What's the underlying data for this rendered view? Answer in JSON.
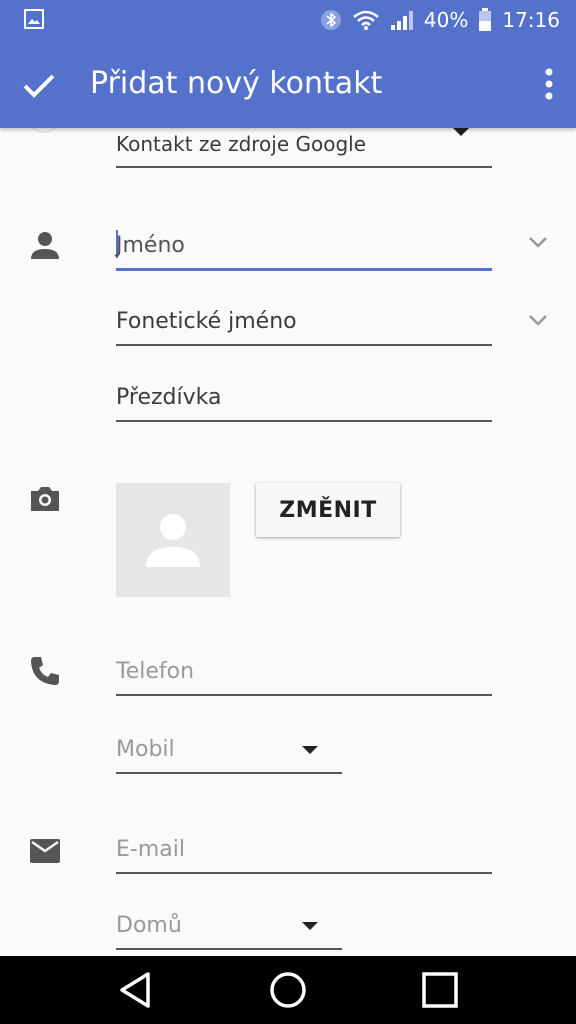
{
  "status_bar": {
    "battery_percent": "40%",
    "time": "17:16"
  },
  "app_bar": {
    "title": "Přidat nový kontakt"
  },
  "account": {
    "source_label": "Kontakt ze zdroje Google"
  },
  "name_section": {
    "name_placeholder": "Jméno",
    "phonetic_placeholder": "Fonetické jméno",
    "nickname_placeholder": "Přezdívka"
  },
  "photo_section": {
    "change_button": "ZMĚNIT"
  },
  "phone_section": {
    "phone_placeholder": "Telefon",
    "type_value": "Mobil"
  },
  "email_section": {
    "email_placeholder": "E-mail",
    "type_value": "Domů"
  },
  "colors": {
    "accent": "#5472cc",
    "background": "#fafafa"
  }
}
